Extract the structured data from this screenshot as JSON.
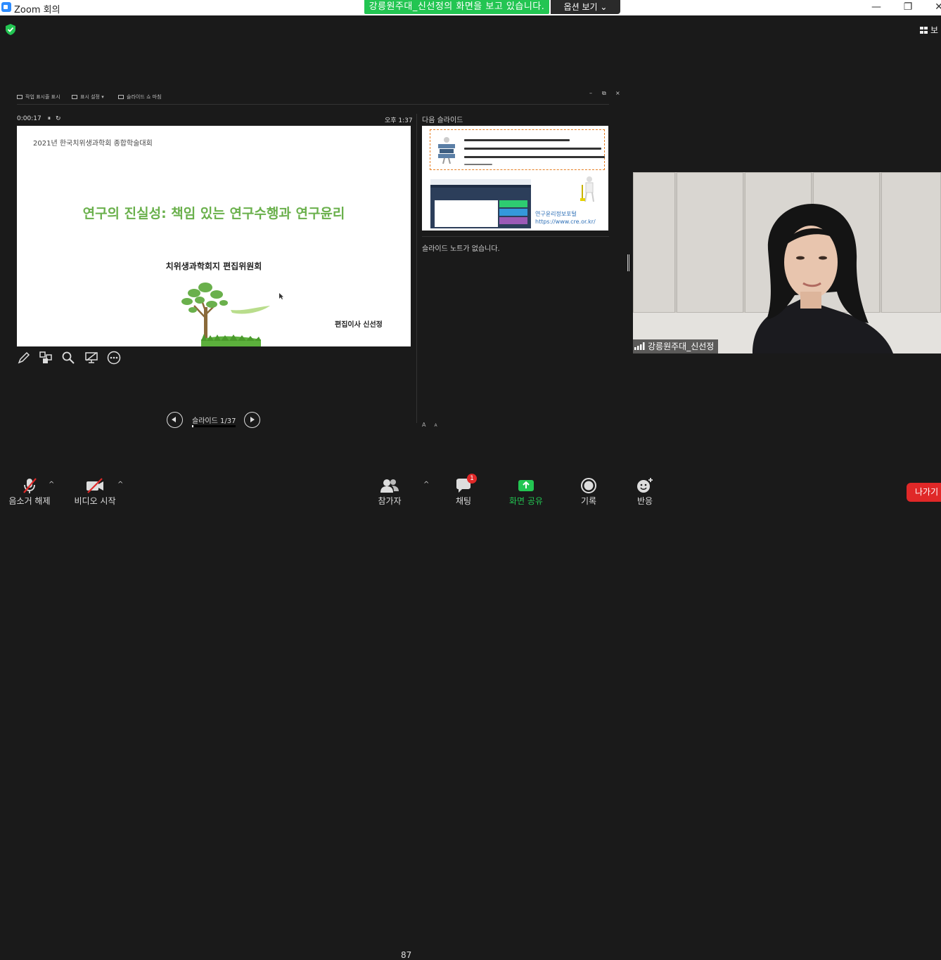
{
  "window": {
    "title": "Zoom 회의",
    "minimize": "—",
    "restore": "❐",
    "close": "✕"
  },
  "share_banner": {
    "text": "강릉원주대_신선정의 화면을 보고 있습니다.",
    "options_label": "옵션 보기",
    "options_caret": "⌄"
  },
  "view_button": {
    "label": "보"
  },
  "presenter": {
    "toolbar": {
      "show_taskbar": "작업 표시줄 표시",
      "display_settings": "표시 설정 ▾",
      "end_slideshow": "슬라이드 쇼 마침"
    },
    "win_minimize": "–",
    "win_restore": "⧉",
    "win_close": "×",
    "timer": "0:00:17",
    "pause_icon": "⏸",
    "restart_icon": "↻",
    "clock": "오후 1:37",
    "current_slide": {
      "conference": "2021년 한국치위생과학회 종합학술대회",
      "title": "연구의 진실성: 책임 있는 연구수행과 연구윤리",
      "committee": "치위생과학회지 편집위원회",
      "author": "편집이사 신선정"
    },
    "next_slide_label": "다음 슬라이드",
    "next_slide": {
      "portal_name": "연구윤리정보포털",
      "portal_url": "https://www.cre.or.kr/"
    },
    "notes": "슬라이드 노트가 없습니다.",
    "font_increase": "A",
    "font_decrease": "A",
    "slide_counter": "슬라이드 1/37",
    "slide_progress": 0.027
  },
  "video": {
    "participant_name": "강릉원주대_신선정"
  },
  "toolbar": {
    "unmute": "음소거 해제",
    "start_video": "비디오 시작",
    "participants": "참가자",
    "participant_count": "87",
    "chat": "채팅",
    "chat_badge": "1",
    "share_screen": "화면 공유",
    "record": "기록",
    "reactions": "반응",
    "leave": "나가기",
    "caret": "^"
  },
  "colors": {
    "share_green": "#23c552",
    "slide_title_green": "#6ab04c",
    "leave_red": "#e02828",
    "toolbar_bg": "#1a1a1a"
  }
}
